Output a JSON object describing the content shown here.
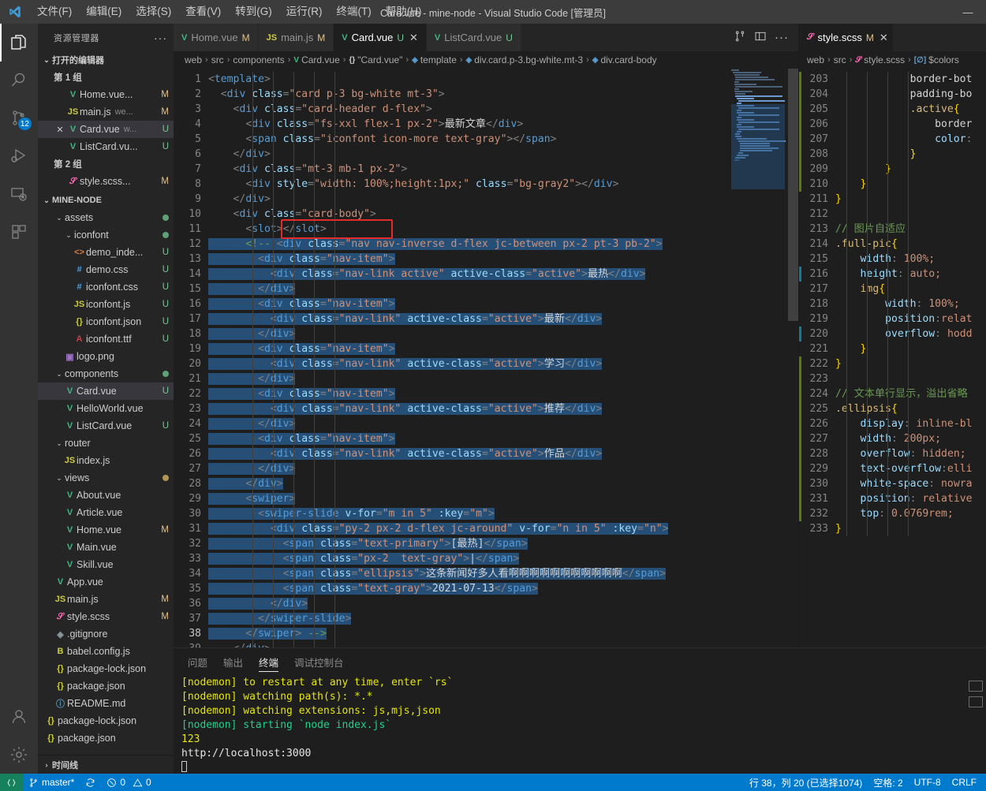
{
  "titlebar": {
    "title": "Card.vue - mine-node - Visual Studio Code [管理员]",
    "menus": [
      "文件(F)",
      "编辑(E)",
      "选择(S)",
      "查看(V)",
      "转到(G)",
      "运行(R)",
      "终端(T)",
      "帮助(H)"
    ],
    "minimize": "—"
  },
  "activitybar": {
    "items": [
      {
        "name": "explorer",
        "active": true
      },
      {
        "name": "search",
        "active": false
      },
      {
        "name": "source-control",
        "active": false,
        "badge": "12"
      },
      {
        "name": "run-debug",
        "active": false
      },
      {
        "name": "remote-explorer",
        "active": false
      },
      {
        "name": "extensions",
        "active": false
      }
    ],
    "bottom": [
      {
        "name": "accounts"
      },
      {
        "name": "settings"
      }
    ]
  },
  "sidebar": {
    "header": "资源管理器",
    "more": "···",
    "open_editors_title": "打开的编辑器",
    "groups": [
      {
        "label": "第 1 组",
        "files": [
          {
            "icon": "vue",
            "name": "Home.vue...",
            "sub": "",
            "state": "M",
            "closable": false
          },
          {
            "icon": "js",
            "name": "main.js",
            "sub": "we...",
            "state": "M",
            "closable": false
          },
          {
            "icon": "vue",
            "name": "Card.vue",
            "sub": "w...",
            "state": "U",
            "closable": true,
            "selected": true
          },
          {
            "icon": "vue",
            "name": "ListCard.vu...",
            "sub": "",
            "state": "U",
            "closable": false
          }
        ]
      },
      {
        "label": "第 2 组",
        "files": [
          {
            "icon": "scss",
            "name": "style.scss...",
            "sub": "",
            "state": "M",
            "closable": false
          }
        ]
      }
    ],
    "project_title": "MINE-NODE",
    "tree": [
      {
        "depth": 1,
        "icon": "folder",
        "name": "assets",
        "state": "dot-green",
        "expanded": true
      },
      {
        "depth": 2,
        "icon": "folder",
        "name": "iconfont",
        "state": "dot-green",
        "expanded": true
      },
      {
        "depth": 3,
        "icon": "html",
        "name": "demo_inde...",
        "state": "U"
      },
      {
        "depth": 3,
        "icon": "css",
        "name": "demo.css",
        "state": "U"
      },
      {
        "depth": 3,
        "icon": "css",
        "name": "iconfont.css",
        "state": "U"
      },
      {
        "depth": 3,
        "icon": "js",
        "name": "iconfont.js",
        "state": "U"
      },
      {
        "depth": 3,
        "icon": "json",
        "name": "iconfont.json",
        "state": "U"
      },
      {
        "depth": 3,
        "icon": "ttf",
        "name": "iconfont.ttf",
        "state": "U"
      },
      {
        "depth": 2,
        "icon": "png",
        "name": "logo.png",
        "state": ""
      },
      {
        "depth": 1,
        "icon": "folder",
        "name": "components",
        "state": "dot-green",
        "expanded": true
      },
      {
        "depth": 2,
        "icon": "vue",
        "name": "Card.vue",
        "state": "U",
        "selected": true
      },
      {
        "depth": 2,
        "icon": "vue",
        "name": "HelloWorld.vue",
        "state": ""
      },
      {
        "depth": 2,
        "icon": "vue",
        "name": "ListCard.vue",
        "state": "U"
      },
      {
        "depth": 1,
        "icon": "folder",
        "name": "router",
        "state": "",
        "expanded": true
      },
      {
        "depth": 2,
        "icon": "js",
        "name": "index.js",
        "state": ""
      },
      {
        "depth": 1,
        "icon": "folder",
        "name": "views",
        "state": "dot-yellow",
        "expanded": true
      },
      {
        "depth": 2,
        "icon": "vue",
        "name": "About.vue",
        "state": ""
      },
      {
        "depth": 2,
        "icon": "vue",
        "name": "Article.vue",
        "state": ""
      },
      {
        "depth": 2,
        "icon": "vue",
        "name": "Home.vue",
        "state": "M"
      },
      {
        "depth": 2,
        "icon": "vue",
        "name": "Main.vue",
        "state": ""
      },
      {
        "depth": 2,
        "icon": "vue",
        "name": "Skill.vue",
        "state": ""
      },
      {
        "depth": 1,
        "icon": "vue",
        "name": "App.vue",
        "state": ""
      },
      {
        "depth": 1,
        "icon": "js",
        "name": "main.js",
        "state": "M"
      },
      {
        "depth": 1,
        "icon": "scss",
        "name": "style.scss",
        "state": "M"
      },
      {
        "depth": 1,
        "icon": "git",
        "name": ".gitignore",
        "state": ""
      },
      {
        "depth": 1,
        "icon": "babel",
        "name": "babel.config.js",
        "state": ""
      },
      {
        "depth": 1,
        "icon": "json",
        "name": "package-lock.json",
        "state": ""
      },
      {
        "depth": 1,
        "icon": "json",
        "name": "package.json",
        "state": ""
      },
      {
        "depth": 1,
        "icon": "md",
        "name": "README.md",
        "state": ""
      },
      {
        "depth": 0,
        "icon": "json",
        "name": "package-lock.json",
        "state": ""
      },
      {
        "depth": 0,
        "icon": "json",
        "name": "package.json",
        "state": ""
      }
    ],
    "footer": "时间线"
  },
  "editor_left": {
    "tabs": [
      {
        "icon": "vue",
        "label": "Home.vue",
        "state": "M",
        "active": false,
        "closable": false
      },
      {
        "icon": "js",
        "label": "main.js",
        "state": "M",
        "active": false,
        "closable": false
      },
      {
        "icon": "vue",
        "label": "Card.vue",
        "state": "U",
        "active": true,
        "closable": true
      },
      {
        "icon": "vue",
        "label": "ListCard.vue",
        "state": "U",
        "active": false,
        "closable": false
      }
    ],
    "actions": [
      "split-editor-icon",
      "toggle-panel-icon",
      "more-actions-icon"
    ],
    "breadcrumb": [
      {
        "label": "web",
        "icon": ""
      },
      {
        "label": "src",
        "icon": ""
      },
      {
        "label": "components",
        "icon": ""
      },
      {
        "label": "Card.vue",
        "icon": "vue"
      },
      {
        "label": "\"Card.vue\"",
        "icon": "braces"
      },
      {
        "label": "template",
        "icon": "symbol"
      },
      {
        "label": "div.card.p-3.bg-white.mt-3",
        "icon": "symbol"
      },
      {
        "label": "div.card-body",
        "icon": "symbol"
      }
    ],
    "first_line": 1,
    "lines": [
      {
        "n": 1,
        "text": "<template>"
      },
      {
        "n": 2,
        "text": "  <div class=\"card p-3 bg-white mt-3\">"
      },
      {
        "n": 3,
        "text": "    <div class=\"card-header d-flex\">"
      },
      {
        "n": 4,
        "text": "      <div class=\"fs-xxl flex-1 px-2\">最新文章</div>"
      },
      {
        "n": 5,
        "text": "      <span class=\"iconfont icon-more text-gray\"></span>"
      },
      {
        "n": 6,
        "text": "    </div>"
      },
      {
        "n": 7,
        "text": "    <div class=\"mt-3 mb-1 px-2\">"
      },
      {
        "n": 8,
        "text": "      <div style=\"width: 100%;height:1px;\" class=\"bg-gray2\"></div>"
      },
      {
        "n": 9,
        "text": "    </div>"
      },
      {
        "n": 10,
        "text": "    <div class=\"card-body\">"
      },
      {
        "n": 11,
        "text": "      <slot></slot>"
      },
      {
        "n": 12,
        "text": "      <!-- <div class=\"nav nav-inverse d-flex jc-between px-2 pt-3 pb-2\">"
      },
      {
        "n": 13,
        "text": "        <div class=\"nav-item\">"
      },
      {
        "n": 14,
        "text": "          <div class=\"nav-link active\" active-class=\"active\">最热</div>"
      },
      {
        "n": 15,
        "text": "        </div>"
      },
      {
        "n": 16,
        "text": "        <div class=\"nav-item\">"
      },
      {
        "n": 17,
        "text": "          <div class=\"nav-link\" active-class=\"active\">最新</div>"
      },
      {
        "n": 18,
        "text": "        </div>"
      },
      {
        "n": 19,
        "text": "        <div class=\"nav-item\">"
      },
      {
        "n": 20,
        "text": "          <div class=\"nav-link\" active-class=\"active\">学习</div>"
      },
      {
        "n": 21,
        "text": "        </div>"
      },
      {
        "n": 22,
        "text": "        <div class=\"nav-item\">"
      },
      {
        "n": 23,
        "text": "          <div class=\"nav-link\" active-class=\"active\">推荐</div>"
      },
      {
        "n": 24,
        "text": "        </div>"
      },
      {
        "n": 25,
        "text": "        <div class=\"nav-item\">"
      },
      {
        "n": 26,
        "text": "          <div class=\"nav-link\" active-class=\"active\">作品</div>"
      },
      {
        "n": 27,
        "text": "        </div>"
      },
      {
        "n": 28,
        "text": "      </div>"
      },
      {
        "n": 29,
        "text": "      <swiper>"
      },
      {
        "n": 30,
        "text": "        <swiper-slide v-for=\"m in 5\" :key=\"m\">"
      },
      {
        "n": 31,
        "text": "          <div class=\"py-2 px-2 d-flex jc-around\" v-for=\"n in 5\" :key=\"n\">"
      },
      {
        "n": 32,
        "text": "            <span class=\"text-primary\">[最热]</span>"
      },
      {
        "n": 33,
        "text": "            <span class=\"px-2  text-gray\">|</span>"
      },
      {
        "n": 34,
        "text": "            <span class=\"ellipsis\">这条新闻好多人看啊啊啊啊啊啊啊啊啊啊啊</span>"
      },
      {
        "n": 35,
        "text": "            <span class=\"text-gray\">2021-07-13</span>"
      },
      {
        "n": 36,
        "text": "          </div>"
      },
      {
        "n": 37,
        "text": "        </swiper-slide>"
      },
      {
        "n": 38,
        "text": "      </swiper> -->"
      },
      {
        "n": 39,
        "text": "    </div>"
      }
    ],
    "highlight_box_line": 11,
    "highlight_box_text": "<slot></slot>",
    "selection_start_line": 12,
    "selection_end_line": 38
  },
  "editor_right": {
    "tab": {
      "icon": "scss",
      "label": "style.scss",
      "state": "M",
      "closable": true
    },
    "breadcrumb": [
      {
        "label": "web"
      },
      {
        "label": "src"
      },
      {
        "label": "style.scss",
        "icon": "scss"
      },
      {
        "label": "$colors",
        "icon": "variable"
      }
    ],
    "lines": [
      {
        "n": 203,
        "text": "            border-bot",
        "chg": "green"
      },
      {
        "n": 204,
        "text": "            padding-bo",
        "chg": "green"
      },
      {
        "n": 205,
        "text": "            .active{",
        "chg": "green"
      },
      {
        "n": 206,
        "text": "                border",
        "chg": "green"
      },
      {
        "n": 207,
        "text": "                color:",
        "chg": "green"
      },
      {
        "n": 208,
        "text": "            }",
        "chg": "green"
      },
      {
        "n": 209,
        "text": "        }",
        "chg": "green"
      },
      {
        "n": 210,
        "text": "    }",
        "chg": "green"
      },
      {
        "n": 211,
        "text": "}",
        "chg": ""
      },
      {
        "n": 212,
        "text": "",
        "chg": ""
      },
      {
        "n": 213,
        "text": "// 图片自适应",
        "chg": ""
      },
      {
        "n": 214,
        "text": ".full-pic{",
        "chg": ""
      },
      {
        "n": 215,
        "text": "    width: 100%;",
        "chg": ""
      },
      {
        "n": 216,
        "text": "    height: auto;",
        "chg": "blue"
      },
      {
        "n": 217,
        "text": "    img{",
        "chg": ""
      },
      {
        "n": 218,
        "text": "        width: 100%;",
        "chg": ""
      },
      {
        "n": 219,
        "text": "        position:relat",
        "chg": ""
      },
      {
        "n": 220,
        "text": "        overflow: hodd",
        "chg": "blue"
      },
      {
        "n": 221,
        "text": "    }",
        "chg": ""
      },
      {
        "n": 222,
        "text": "}",
        "chg": "green"
      },
      {
        "n": 223,
        "text": "",
        "chg": "green"
      },
      {
        "n": 224,
        "text": "// 文本单行显示，溢出省略",
        "chg": "green"
      },
      {
        "n": 225,
        "text": ".ellipsis{",
        "chg": "green"
      },
      {
        "n": 226,
        "text": "    display: inline-bl",
        "chg": "green"
      },
      {
        "n": 227,
        "text": "    width: 200px;",
        "chg": "green"
      },
      {
        "n": 228,
        "text": "    overflow: hidden;",
        "chg": "green"
      },
      {
        "n": 229,
        "text": "    text-overflow:elli",
        "chg": "green"
      },
      {
        "n": 230,
        "text": "    white-space: nowra",
        "chg": "green"
      },
      {
        "n": 231,
        "text": "    position: relative",
        "chg": "green"
      },
      {
        "n": 232,
        "text": "    top: 0.0769rem;",
        "chg": "green"
      },
      {
        "n": 233,
        "text": "}",
        "chg": ""
      }
    ]
  },
  "panel": {
    "tabs": [
      "问题",
      "输出",
      "终端",
      "调试控制台"
    ],
    "active_tab": "终端",
    "terminal_lines": [
      {
        "text": "[nodemon] to restart at any time, enter `rs`",
        "color": "yellow"
      },
      {
        "text": "[nodemon] watching path(s): *.*",
        "color": "yellow"
      },
      {
        "text": "[nodemon] watching extensions: js,mjs,json",
        "color": "yellow"
      },
      {
        "text": "[nodemon] starting `node index.js`",
        "color": "green"
      },
      {
        "text": "123",
        "color": "yellow"
      },
      {
        "text": "http://localhost:3000",
        "color": "white"
      }
    ]
  },
  "statusbar": {
    "remote_icon": "remote-icon",
    "branch": "master*",
    "sync_icon": "sync-icon",
    "errors": "0",
    "warnings": "0",
    "cursor": "行 38，列 20 (已选择1074)",
    "indent": "空格: 2",
    "encoding": "UTF-8",
    "eol": "CRLF"
  },
  "colors": {
    "accent": "#007acc",
    "remote_green": "#16825d",
    "selection": "#264f78",
    "highlight_box": "#e32b2b",
    "modified": "#e2c08d",
    "untracked": "#73c991"
  }
}
